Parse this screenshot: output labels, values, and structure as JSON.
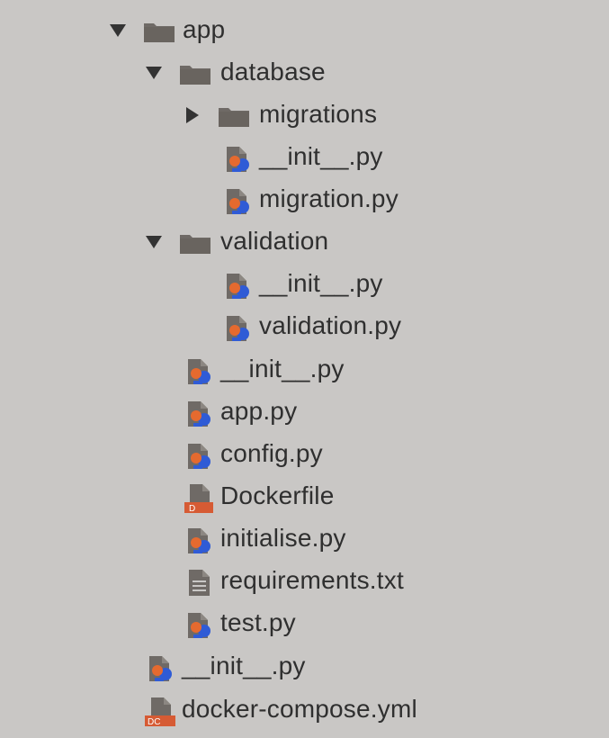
{
  "colors": {
    "background": "#c9c7c5",
    "text": "#2f2f2f",
    "folder": "#6f6a66",
    "arrow": "#333333",
    "python_blue": "#2f5bd6",
    "python_orange": "#e56a2f",
    "docker_red": "#d65b34"
  },
  "tree": {
    "app": {
      "label": "app",
      "icon": "folder-icon",
      "expanded": true
    },
    "database": {
      "label": "database",
      "icon": "folder-icon",
      "expanded": true
    },
    "migrations": {
      "label": "migrations",
      "icon": "folder-icon",
      "expanded": false
    },
    "database_init": {
      "label": "__init__.py",
      "icon": "python-file-icon"
    },
    "migration_py": {
      "label": "migration.py",
      "icon": "python-file-icon"
    },
    "validation": {
      "label": "validation",
      "icon": "folder-icon",
      "expanded": true
    },
    "validation_init": {
      "label": "__init__.py",
      "icon": "python-file-icon"
    },
    "validation_py": {
      "label": "validation.py",
      "icon": "python-file-icon"
    },
    "app_init": {
      "label": "__init__.py",
      "icon": "python-file-icon"
    },
    "app_py": {
      "label": "app.py",
      "icon": "python-file-icon"
    },
    "config_py": {
      "label": "config.py",
      "icon": "python-file-icon"
    },
    "dockerfile": {
      "label": "Dockerfile",
      "icon": "dockerfile-icon",
      "badge": "D"
    },
    "initialise_py": {
      "label": "initialise.py",
      "icon": "python-file-icon"
    },
    "requirements_txt": {
      "label": "requirements.txt",
      "icon": "text-file-icon"
    },
    "test_py": {
      "label": "test.py",
      "icon": "python-file-icon"
    },
    "root_init": {
      "label": "__init__.py",
      "icon": "python-file-icon"
    },
    "docker_compose": {
      "label": "docker-compose.yml",
      "icon": "docker-compose-icon",
      "badge": "DC"
    }
  }
}
